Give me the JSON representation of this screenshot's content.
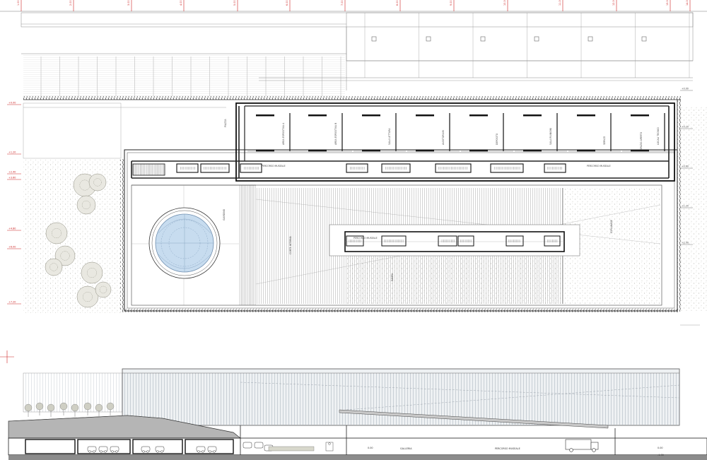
{
  "colors": {
    "line": "#333333",
    "thin": "#9a9a9a",
    "wall": "#111111",
    "accent_red": "#cc2222",
    "pool": "#c7dcef",
    "pool_stroke": "#6f8fb0",
    "hatch": "#b7b7b7",
    "gravel": "#f3f2ec",
    "ground": "#8c8c8c"
  },
  "plan": {
    "rooms": [
      "AREA ESPOSITIVA A",
      "AREA ESPOSITIVA B",
      "SALA LETTURA",
      "AUDITORIUM",
      "DEPOSITO",
      "SALA RIUNIONI",
      "SERVIZI",
      "LOCALI TECNICI"
    ],
    "gallery_label": "PERCORSO MUSEALE",
    "corridor_labels": [
      "PERCORSO MUSEALE",
      "PERCORSO MUSEALE"
    ],
    "court_labels": [
      "CORTE INTERNA",
      "GIARDINO",
      "RAMPA",
      "ESPLANADE",
      "SPAZIO APERTO",
      "PIAZZA"
    ],
    "levels_left": [
      "+0.00",
      "+1.20",
      "+2.40",
      "+3.60",
      "+4.80",
      "+6.00",
      "+7.20"
    ],
    "levels_right": [
      "+0.00",
      "+0.20",
      "+0.60",
      "+1.20",
      "+2.00"
    ],
    "top_ruler_marks": [
      "1.00",
      "2.00",
      "3.00",
      "4.00",
      "5.00",
      "6.00",
      "7.00",
      "8.00",
      "9.00",
      "10.00",
      "11.00",
      "12.00",
      "13.00",
      "14.00"
    ]
  },
  "section": {
    "labels": [
      "0.00",
      "GALLERIA",
      "PERCORSO MUSEALE",
      "0.00",
      "-1.00"
    ],
    "cars": 7
  }
}
